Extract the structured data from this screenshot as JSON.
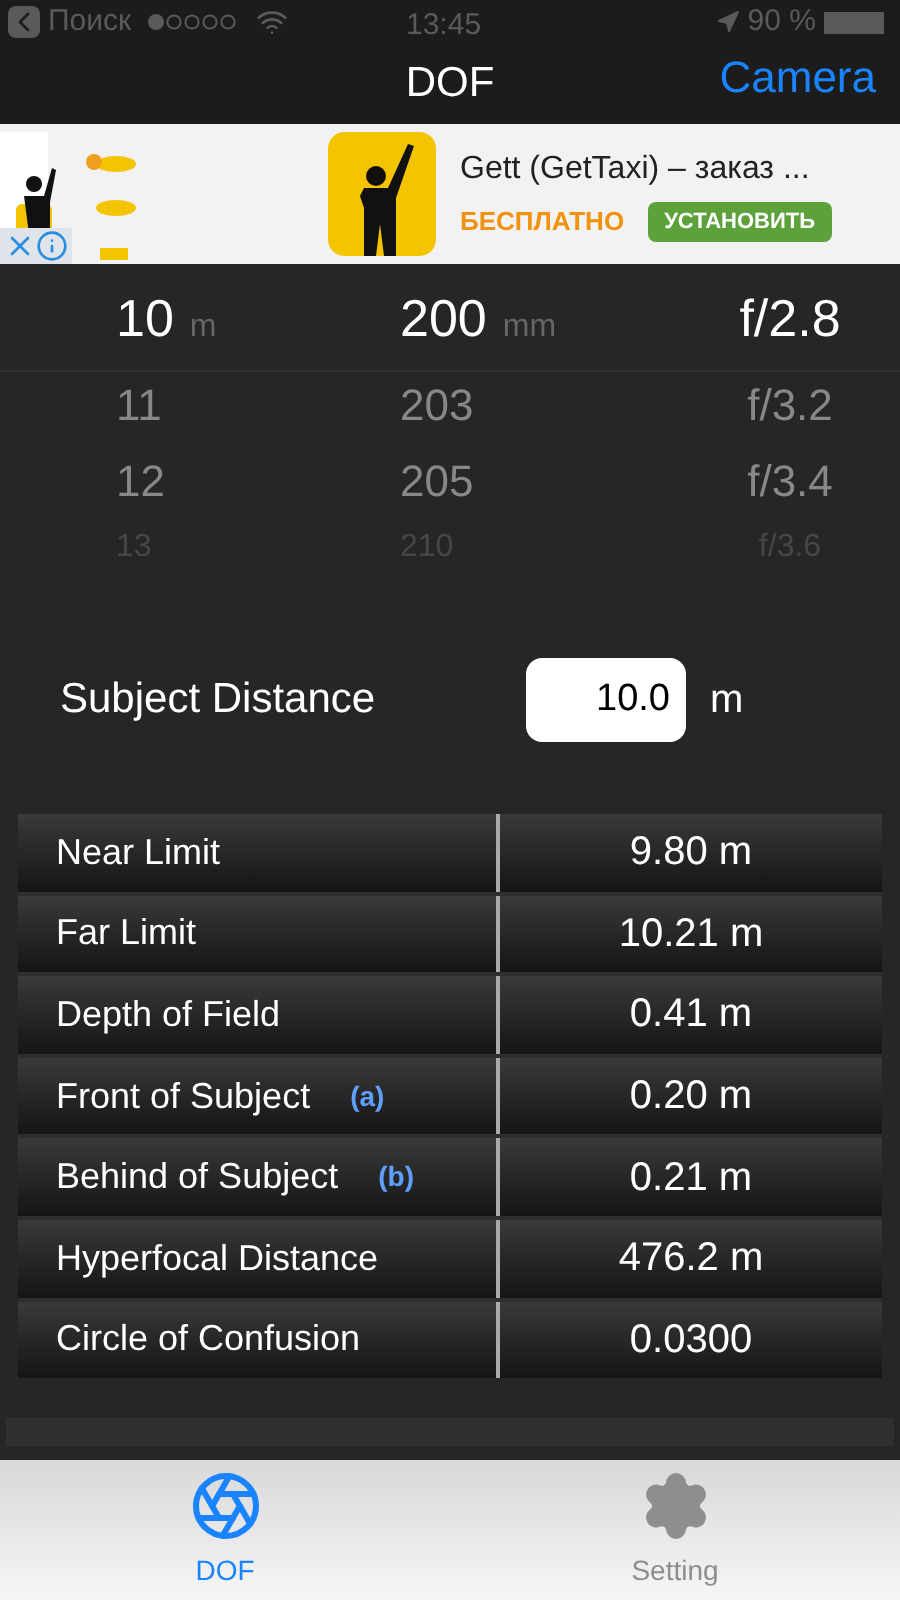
{
  "status_bar": {
    "back": "Поиск",
    "time": "13:45",
    "battery": "90 %"
  },
  "nav": {
    "title": "DOF",
    "action": "Camera"
  },
  "ad": {
    "title": "Gett (GetTaxi) – заказ ...",
    "price": "БЕСПЛАТНО",
    "button": "УСТАНОВИТЬ"
  },
  "picker": {
    "columns": [
      {
        "unit": "m",
        "rows": [
          {
            "value": "10",
            "selected": true
          },
          {
            "value": "11",
            "selected": false
          },
          {
            "value": "12",
            "selected": false
          },
          {
            "value": "13",
            "selected": false
          }
        ]
      },
      {
        "unit": "mm",
        "rows": [
          {
            "value": "200",
            "selected": true
          },
          {
            "value": "203",
            "selected": false
          },
          {
            "value": "205",
            "selected": false
          },
          {
            "value": "210",
            "selected": false
          }
        ]
      },
      {
        "rows": [
          {
            "value": "f/2.8",
            "selected": true
          },
          {
            "value": "f/3.2",
            "selected": false
          },
          {
            "value": "f/3.4",
            "selected": false
          },
          {
            "value": "f/3.6",
            "selected": false
          }
        ]
      }
    ]
  },
  "subject_distance": {
    "label": "Subject Distance",
    "value": "10.0",
    "unit": "m"
  },
  "results": [
    {
      "label": "Near Limit",
      "value": "9.80 m"
    },
    {
      "label": "Far Limit",
      "value": "10.21 m"
    },
    {
      "label": "Depth of Field",
      "value": "0.41 m"
    },
    {
      "label": "Front of Subject",
      "note": "(a)",
      "value": "0.20 m"
    },
    {
      "label": "Behind of Subject",
      "note": "(b)",
      "value": "0.21 m"
    },
    {
      "label": "Hyperfocal Distance",
      "value": "476.2 m"
    },
    {
      "label": "Circle of Confusion",
      "value": "0.0300"
    }
  ],
  "tabs": [
    {
      "label": "DOF",
      "kind": "aperture",
      "selected": true
    },
    {
      "label": "Setting",
      "kind": "gear",
      "selected": false
    }
  ]
}
